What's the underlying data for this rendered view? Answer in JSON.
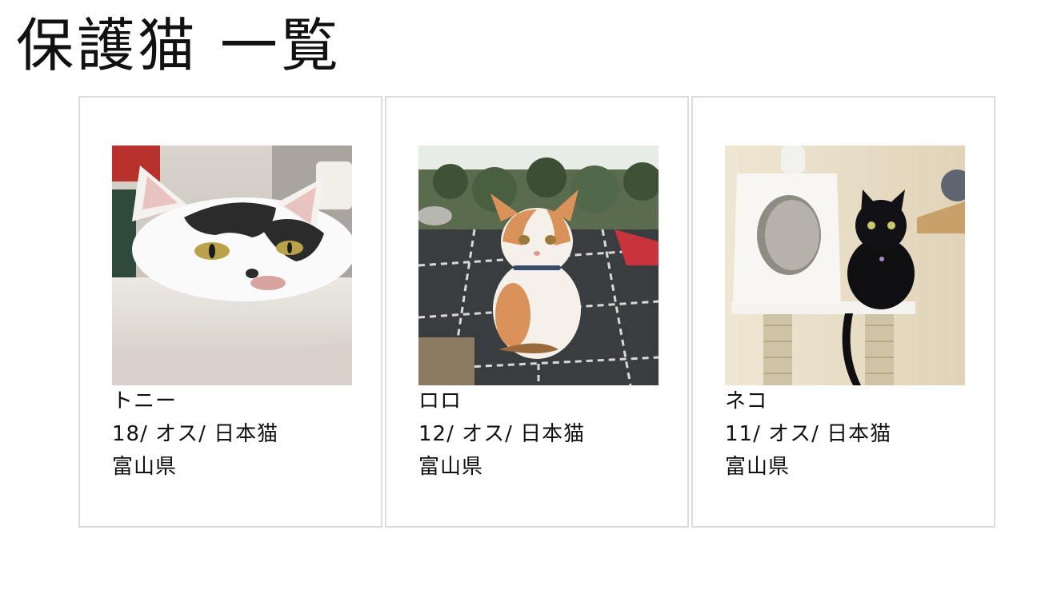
{
  "page": {
    "title": "保護猫 一覧"
  },
  "cats": [
    {
      "name": "トニー",
      "details": "18/ オス/ 日本猫",
      "location": "富山県",
      "photo": "cat-photo-white-black-cat-lying"
    },
    {
      "name": "ロロ",
      "details": "12/ オス/ 日本猫",
      "location": "富山県",
      "photo": "cat-photo-orange-white-cat-sitting"
    },
    {
      "name": "ネコ",
      "details": "11/ オス/ 日本猫",
      "location": "富山県",
      "photo": "cat-photo-black-cat-on-tower"
    }
  ]
}
